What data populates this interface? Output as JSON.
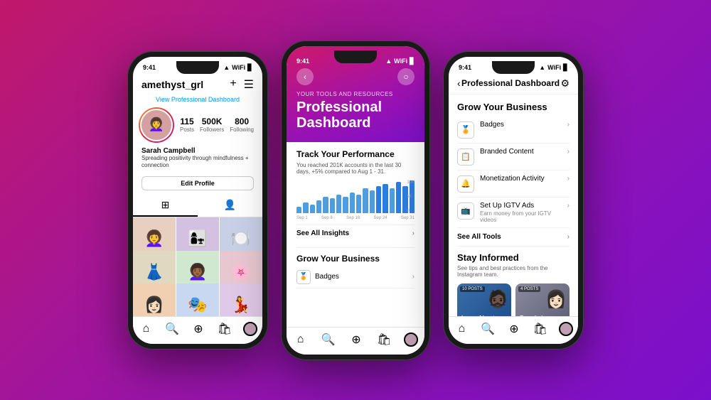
{
  "background": {
    "gradient_start": "#c0186a",
    "gradient_end": "#7b10cc"
  },
  "phone1": {
    "status": {
      "time": "9:41",
      "signal": "●●●",
      "wifi": "▲",
      "battery": "▊"
    },
    "username": "amethyst_grl",
    "pro_dashboard_link": "View Professional Dashboard",
    "stats": [
      {
        "number": "115",
        "label": "Posts"
      },
      {
        "number": "500K",
        "label": "Followers"
      },
      {
        "number": "800",
        "label": "Following"
      }
    ],
    "profile_name": "Sarah Campbell",
    "profile_bio": "Spreading positivity through mindfulness + connection",
    "edit_profile_btn": "Edit Profile",
    "photos": [
      "👩‍🦱",
      "👩‍👧",
      "🍽️",
      "👗",
      "👩🏾‍🦱",
      "🌸",
      "👩🏻",
      "🎭",
      "💃"
    ],
    "nav": {
      "home": "⌂",
      "search": "🔍",
      "add": "➕",
      "shop": "🛍",
      "profile": "👤"
    }
  },
  "phone2": {
    "status": {
      "time": "9:41",
      "signal": "●●●",
      "wifi": "▲",
      "battery": "▊"
    },
    "dashboard": {
      "subtitle": "YOUR TOOLS AND RESOURCES",
      "title": "Professional\nDashboard",
      "track_title": "Track Your Performance",
      "track_text": "You reached 201K accounts in the last 30 days, +5% compared to Aug 1 - 31.",
      "chart_bars": [
        3,
        5,
        4,
        6,
        8,
        7,
        9,
        8,
        10,
        9,
        12,
        11,
        13,
        14,
        12,
        15,
        13,
        16
      ],
      "chart_y_labels": [
        "10K",
        "5K",
        "0"
      ],
      "chart_x_labels": [
        "Sep 1",
        "Sep 8",
        "Sep 16",
        "Sep 24",
        "Sep 31"
      ],
      "see_all_insights": "See All Insights",
      "grow_title": "Grow Your Business",
      "badges_label": "Badges"
    },
    "nav": {
      "home": "⌂",
      "search": "🔍",
      "add": "➕",
      "shop": "🛍",
      "profile": "👤"
    }
  },
  "phone3": {
    "status": {
      "time": "9:41",
      "signal": "●●●",
      "wifi": "▲",
      "battery": "▊"
    },
    "header": {
      "back": "‹",
      "title": "Professional Dashboard",
      "settings": "⚙"
    },
    "grow_section": {
      "title": "Grow Your Business",
      "items": [
        {
          "icon": "🏅",
          "label": "Badges",
          "sublabel": ""
        },
        {
          "icon": "📋",
          "label": "Branded Content",
          "sublabel": ""
        },
        {
          "icon": "🔔",
          "label": "Monetization Activity",
          "sublabel": ""
        },
        {
          "icon": "📺",
          "label": "Set Up IGTV Ads",
          "sublabel": "Earn money from your IGTV videos"
        }
      ],
      "see_all": "See All Tools"
    },
    "stay_section": {
      "title": "Stay Informed",
      "subtitle": "See tips and best practices from the Instagram team.",
      "cards": [
        {
          "badge": "10 POSTS",
          "label": "Learn About Insights",
          "person": "🧔🏿"
        },
        {
          "badge": "4 POSTS",
          "label": "Branded Content",
          "person": "👩🏻"
        }
      ]
    },
    "nav": {
      "home": "⌂",
      "search": "🔍",
      "add": "➕",
      "shop": "🛍",
      "profile": "👤"
    }
  }
}
